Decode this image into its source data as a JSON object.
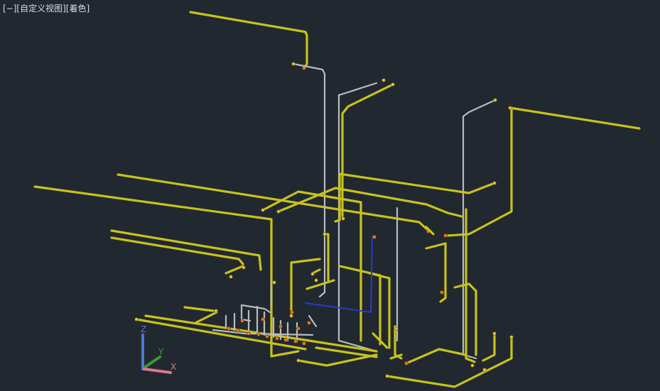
{
  "viewport": {
    "label": {
      "minimize": "[−]",
      "view": "[自定义视图]",
      "style": "[着色]"
    }
  },
  "ucs_icon": {
    "z_label": "Z",
    "y_label": "Y",
    "x_label": "X",
    "colors": {
      "z": "#4a78d8",
      "y": "#3a9a3a",
      "x": "#d87a8a"
    }
  },
  "colors": {
    "background": "#212830",
    "pipe_yellow": "#c8c21a",
    "pipe_white": "#b8bcc0",
    "pipe_blue": "#2a3cc8",
    "fitting_orange": "#e87a22"
  }
}
